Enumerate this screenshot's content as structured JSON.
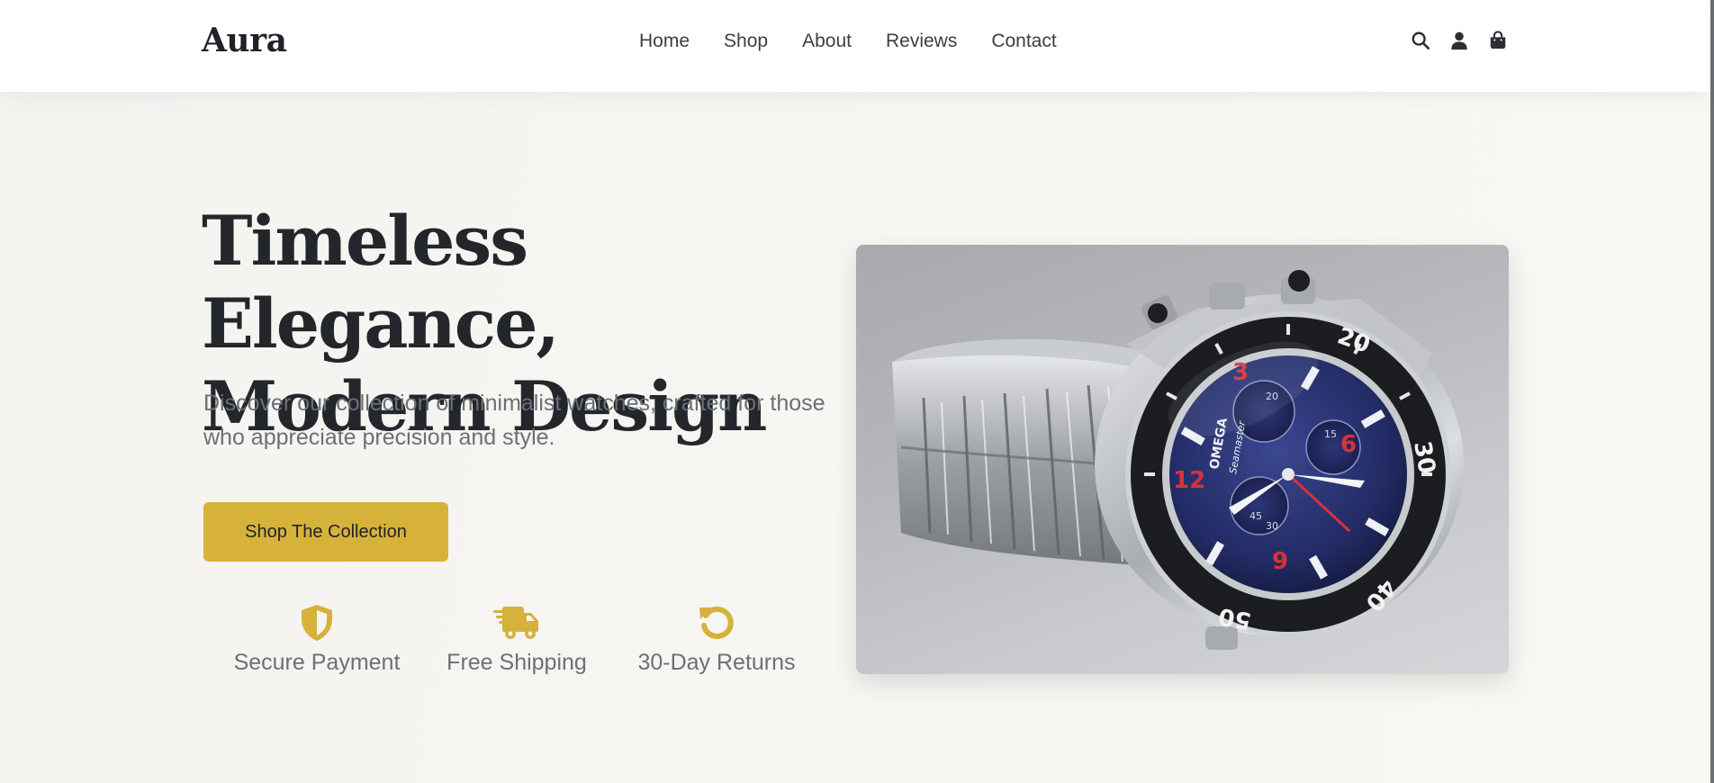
{
  "brand": {
    "logo": "Aura"
  },
  "nav": {
    "items": [
      {
        "label": "Home"
      },
      {
        "label": "Shop"
      },
      {
        "label": "About"
      },
      {
        "label": "Reviews"
      },
      {
        "label": "Contact"
      }
    ]
  },
  "header_icons": [
    "search-icon",
    "user-icon",
    "shopping-bag-icon"
  ],
  "hero": {
    "title_line1": "Timeless Elegance,",
    "title_line2": "Modern Design",
    "subtitle": "Discover our collection of minimalist watches, crafted for those who appreciate precision and style.",
    "cta_label": "Shop The Collection",
    "image_icon": "chronograph-watch-photo"
  },
  "features": [
    {
      "label": "Secure Payment",
      "icon": "shield-icon"
    },
    {
      "label": "Free Shipping",
      "icon": "truck-icon"
    },
    {
      "label": "30-Day Returns",
      "icon": "return-arrow-icon"
    }
  ],
  "watch_face": {
    "brand": "OMEGA",
    "model": "Seamaster",
    "bezel_numbers": [
      "20",
      "30",
      "40",
      "50"
    ],
    "markers": [
      "12",
      "3",
      "6",
      "9"
    ],
    "subdials": [
      "20",
      "15",
      "45",
      "30"
    ]
  },
  "colors": {
    "accent": "#d6b23a",
    "text_dark": "#23262b",
    "text_muted": "#6b7078",
    "header_bg": "#ffffff",
    "page_bg": "#f6f5f2"
  }
}
